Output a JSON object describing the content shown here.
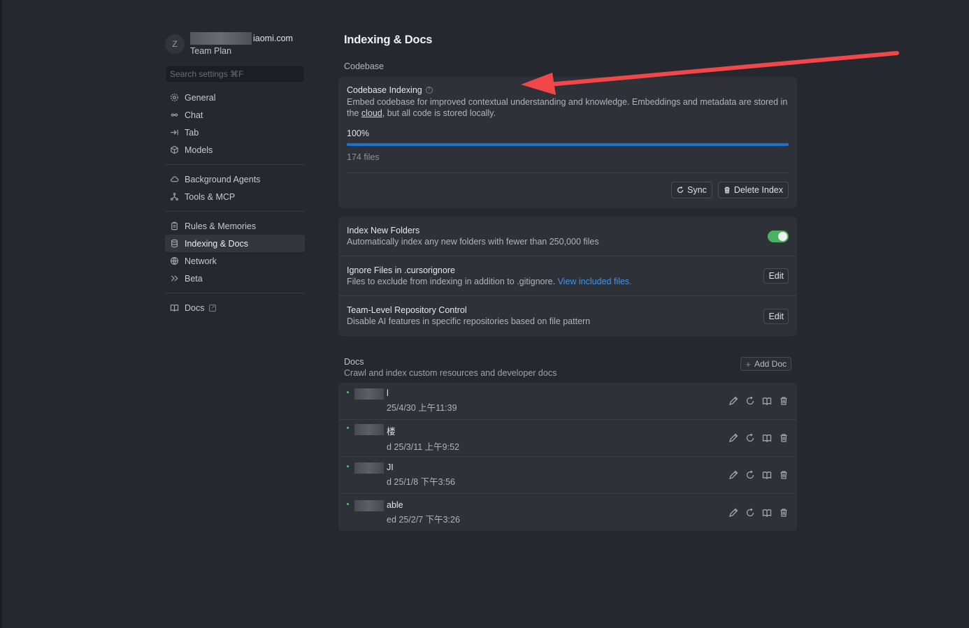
{
  "profile": {
    "avatar_letter": "Z",
    "email_visible": "iaomi.com",
    "plan": "Team Plan"
  },
  "search": {
    "placeholder": "Search settings ⌘F"
  },
  "sidebar": {
    "groups": [
      [
        {
          "label": "General",
          "icon": "gear-icon"
        },
        {
          "label": "Chat",
          "icon": "infinity-icon"
        },
        {
          "label": "Tab",
          "icon": "tab-arrow-icon"
        },
        {
          "label": "Models",
          "icon": "cube-icon"
        }
      ],
      [
        {
          "label": "Background Agents",
          "icon": "cloud-icon"
        },
        {
          "label": "Tools & MCP",
          "icon": "nodes-icon"
        }
      ],
      [
        {
          "label": "Rules & Memories",
          "icon": "clipboard-icon"
        },
        {
          "label": "Indexing & Docs",
          "icon": "database-icon",
          "active": true
        },
        {
          "label": "Network",
          "icon": "globe-icon"
        },
        {
          "label": "Beta",
          "icon": "chevrons-icon"
        }
      ],
      [
        {
          "label": "Docs",
          "icon": "book-icon",
          "external": true
        }
      ]
    ]
  },
  "main": {
    "title": "Indexing & Docs",
    "codebase_label": "Codebase",
    "indexing": {
      "title": "Codebase Indexing",
      "desc_before": "Embed codebase for improved contextual understanding and knowledge. Embeddings and metadata are stored in the ",
      "desc_link": "cloud",
      "desc_after": ", but all code is stored locally.",
      "percent": "100%",
      "progress_value": 100,
      "files": "174 files",
      "sync_label": "Sync",
      "delete_label": "Delete Index"
    },
    "settings": [
      {
        "title": "Index New Folders",
        "desc": "Automatically index any new folders with fewer than 250,000 files",
        "control": "toggle",
        "on": true
      },
      {
        "title": "Ignore Files in .cursorignore",
        "desc": "Files to exclude from indexing in addition to .gitignore. ",
        "link": "View included files.",
        "control": "edit",
        "button": "Edit"
      },
      {
        "title": "Team-Level Repository Control",
        "desc": "Disable AI features in specific repositories based on file pattern",
        "control": "edit",
        "button": "Edit"
      }
    ],
    "docs": {
      "title": "Docs",
      "subtitle": "Crawl and index custom resources and developer docs",
      "add_label": "Add Doc",
      "items": [
        {
          "name": "l",
          "date": "25/4/30 上午11:39"
        },
        {
          "name": "楼",
          "date": "d 25/3/11 上午9:52"
        },
        {
          "name": "JI",
          "date": "d 25/1/8 下午3:56"
        },
        {
          "name": "able",
          "date": "ed 25/2/7 下午3:26"
        }
      ]
    }
  },
  "colors": {
    "background": "#262830",
    "card": "#2f3139",
    "accent_blue": "#1d72d8",
    "toggle_green": "#4ab161",
    "arrow_red": "#f04848"
  }
}
